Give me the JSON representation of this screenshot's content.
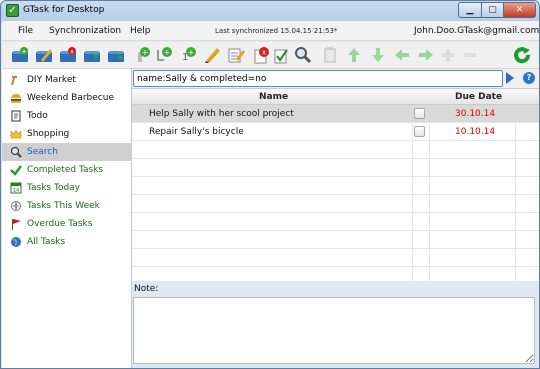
{
  "window": {
    "title": "GTask for Desktop"
  },
  "menubar": {
    "items": [
      "File",
      "Synchronization",
      "Help"
    ],
    "sync_status": "Last synchronized 15.04.15 21:53*",
    "user_email": "John.Doo.GTask@gmail.com"
  },
  "search": {
    "query": "name:Sally & completed=no"
  },
  "sidebar": {
    "items": [
      {
        "label": "DIY Market",
        "icon": "hammer-icon"
      },
      {
        "label": "Weekend Barbecue",
        "icon": "burger-icon"
      },
      {
        "label": "Todo",
        "icon": "notepad-icon"
      },
      {
        "label": "Shopping",
        "icon": "crown-icon"
      },
      {
        "label": "Search",
        "icon": "magnifier-icon"
      },
      {
        "label": "Completed Tasks",
        "icon": "checkmark-icon"
      },
      {
        "label": "Tasks Today",
        "icon": "calendar-icon"
      },
      {
        "label": "Tasks This Week",
        "icon": "compass-icon"
      },
      {
        "label": "Overdue Tasks",
        "icon": "flag-icon"
      },
      {
        "label": "All Tasks",
        "icon": "globe-icon"
      }
    ],
    "selected": "Search"
  },
  "table": {
    "headers": {
      "name": "Name",
      "due": "Due Date"
    },
    "rows": [
      {
        "name": "Help Sally with her scool project",
        "due": "30.10.14",
        "completed": false
      },
      {
        "name": "Repair Sally's bicycle",
        "due": "10.10.14",
        "completed": false
      }
    ]
  },
  "note": {
    "label": "Note:"
  },
  "colors": {
    "accent": "#1f5fb4",
    "due_date": "#e00000",
    "green_list": "#1d6b1d"
  }
}
